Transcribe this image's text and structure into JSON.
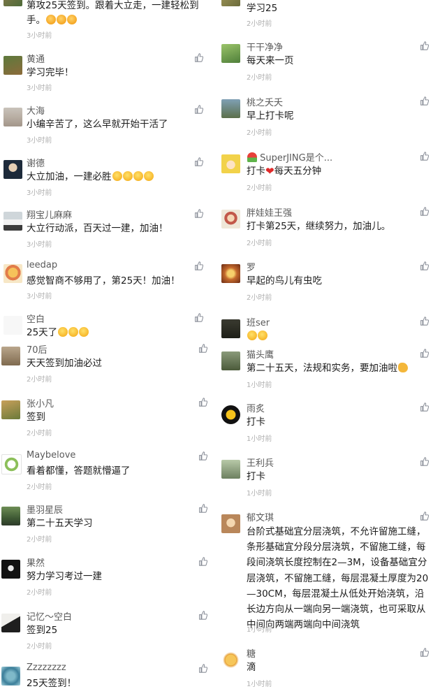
{
  "left": [
    {
      "name": "",
      "text": "第攻25天签到。跟着大立走，一建轻松到手。",
      "emojis": [
        "fist",
        "fist",
        "fist"
      ],
      "time": "3小时前"
    },
    {
      "name": "黄通",
      "text": "学习完毕！",
      "emojis": [],
      "time": "3小时前"
    },
    {
      "name": "大海",
      "text": "小编辛苦了，这么早就开始干活了",
      "emojis": [],
      "time": "3小时前"
    },
    {
      "name": "谢德",
      "text": "大立加油，一建必胜",
      "emojis": [
        "face",
        "face",
        "face",
        "face"
      ],
      "time": "3小时前"
    },
    {
      "name": "翔宝儿麻麻",
      "text": "大立行动派，百天过一建，加油！",
      "emojis": [],
      "time": "3小时前"
    },
    {
      "name": "leedap",
      "text": "感觉智商不够用了，第25天！加油！",
      "emojis": [],
      "time": "3小时前"
    },
    {
      "name": "空白",
      "text": "25天了",
      "emojis": [
        "face",
        "face",
        "face"
      ],
      "time": ""
    },
    {
      "name": "70后",
      "text": "天天签到加油必过",
      "emojis": [],
      "time": "2小时前"
    },
    {
      "name": "张小凡",
      "text": "签到",
      "emojis": [],
      "time": "2小时前"
    },
    {
      "name": "Maybelove",
      "text": "看着都懂，答题就懵逼了",
      "emojis": [],
      "time": "2小时前"
    },
    {
      "name": "墨羽星辰",
      "text": "第二十五天学习",
      "emojis": [],
      "time": "2小时前"
    },
    {
      "name": "果然",
      "text": "努力学习考过一建",
      "emojis": [],
      "time": "2小时前"
    },
    {
      "name": "记忆～空白",
      "text": "签到25",
      "emojis": [],
      "time": "2小时前"
    },
    {
      "name": "Zzzzzzzz",
      "text": "25天签到！",
      "emojis": [],
      "time": ""
    }
  ],
  "right": [
    {
      "name": "",
      "text": "学习25",
      "emojis": [],
      "time": "2小时前"
    },
    {
      "name": "干干净净",
      "text": "每天来一页",
      "emojis": [],
      "time": "2小时前"
    },
    {
      "name": "桃之夭夭",
      "text": "早上打卡呢",
      "emojis": [],
      "time": "2小时前"
    },
    {
      "name": "SuperJING是个...",
      "text": "打卡",
      "emojis": [],
      "text2": "每天五分钟",
      "time": "2小时前",
      "prefix_emoji": "melon",
      "heart": "❤"
    },
    {
      "name": "胖娃娃王强",
      "text": "打卡第25天，继续努力，加油儿。",
      "emojis": [],
      "time": "2小时前"
    },
    {
      "name": "罗",
      "text": "早起的鸟儿有虫吃",
      "emojis": [],
      "time": "2小时前"
    },
    {
      "name": "班ser",
      "text": "",
      "emojis": [
        "grin",
        "face"
      ],
      "time": ""
    },
    {
      "name": "猫头鹰",
      "text": "第二十五天，法规和实务，要加油啦",
      "emojis": [
        "arm"
      ],
      "time": "1小时前"
    },
    {
      "name": "雨炙",
      "text": "打卡",
      "emojis": [],
      "time": "1小时前"
    },
    {
      "name": "王利兵",
      "text": "打卡",
      "emojis": [],
      "time": "1小时前"
    },
    {
      "name": "郁文琪",
      "text": "台阶式基础宜分层浇筑，不允许留施工缝，条形基础宜分段分层浇筑，不留施工缝，每段间浇筑长度控制在2—3M，设备基础宜分层浇筑，不留施工缝，每层混凝土厚度为20—30CM，每层混凝土从低处开始浇筑，沿长边方向从一端向另一端浇筑，也可采取从中间向两端两端向中间浇筑",
      "emojis": [],
      "time": "1小时前"
    },
    {
      "name": "糖",
      "text": "滴",
      "emojis": [],
      "time": "1小时前"
    }
  ],
  "colors": {
    "name": "#5a5a5a",
    "time": "#b0b0b0",
    "text": "#1c1c1c",
    "like": "#8a8f99"
  },
  "icons": {
    "like": "thumbs-up-icon"
  }
}
